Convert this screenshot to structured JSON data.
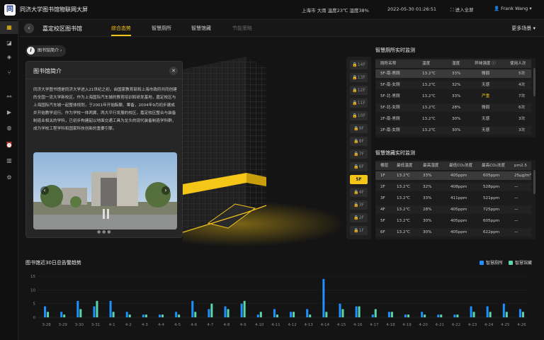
{
  "app": {
    "logo_char": "同",
    "title": "同济大学图书馆物联网大屏"
  },
  "topbar": {
    "location": "上海市",
    "weather": "大雨",
    "temperature": "温度23℃",
    "humidity": "湿度38%",
    "datetime": "2022-05-30 01:26:51",
    "fullscreen_label": "进入全屏",
    "user": "Frank Wang"
  },
  "sidebar": {
    "icons": [
      "dashboard-icon",
      "chart-icon",
      "layers-icon",
      "branch-icon",
      "network-icon",
      "video-icon",
      "palette-icon",
      "alarm-icon",
      "bar-chart-icon",
      "settings-icon"
    ]
  },
  "nav": {
    "title": "嘉定校区图书馆",
    "tabs": [
      {
        "label": "综合态势",
        "state": "active"
      },
      {
        "label": "智慧厕所",
        "state": "normal"
      },
      {
        "label": "智慧馆藏",
        "state": "normal"
      },
      {
        "label": "节能策略",
        "state": "disabled"
      }
    ],
    "scenes_label": "更多场景"
  },
  "intro": {
    "pill_label": "图书馆简介",
    "card_title": "图书馆简介",
    "text": "同济大学图书馆是同济大学进入21世纪之初，由国家教育部和上海市政府共同创建的全国一流大学新校区。作为上海国际汽车城的教育培训和研发基地，嘉定校区与上海国际汽车城一起整体规划，于2001年开始酝酿、筹备，2004年9月初步建成并开始教学运行。作为学校一体两翼、两大平行发展的校区，嘉定校区整合与装备制造业相关的学科，已初步构建起以地面交通工具为龙头的现代装备制造学科群，成为学校工程学科和国家科技创新的重要引擎。",
    "carousel_dots": "● ● ●"
  },
  "floors": [
    "14F",
    "13F",
    "12F",
    "11F",
    "10F",
    "9F",
    "8F",
    "7F",
    "6F",
    "5F",
    "4F",
    "3F",
    "2F",
    "1F"
  ],
  "selected_floor": "5F",
  "toilet": {
    "title": "智慧厕所实时监测",
    "headers": [
      "厕所名称",
      "温度",
      "湿度",
      "异味强度",
      "使用人次"
    ],
    "rows": [
      [
        "5F-南-男厕",
        "13.2℃",
        "33%",
        "微弱",
        "5次"
      ],
      [
        "5F-南-女厕",
        "13.2℃",
        "32%",
        "无感",
        "4次"
      ],
      [
        "5F-北-男厕",
        "13.2℃",
        "33%",
        "严重",
        "7次"
      ],
      [
        "5F-北-女厕",
        "13.2℃",
        "28%",
        "微弱",
        "6次"
      ],
      [
        "2F-南-男厕",
        "13.2℃",
        "30%",
        "无感",
        "3次"
      ],
      [
        "2F-南-女厕",
        "13.2℃",
        "30%",
        "无感",
        "3次"
      ]
    ]
  },
  "collection": {
    "title": "智慧馆藏实时监测",
    "headers": [
      "楼层",
      "最低温度",
      "最高湿度",
      "最低CO₂浓度",
      "最高CO₂浓度",
      "pm2.5"
    ],
    "rows": [
      [
        "1F",
        "13.2℃",
        "33%",
        "405ppm",
        "605ppm",
        "25μg/m³"
      ],
      [
        "2F",
        "13.2℃",
        "32%",
        "408ppm",
        "528ppm",
        "—"
      ],
      [
        "3F",
        "13.2℃",
        "33%",
        "411ppm",
        "521ppm",
        "—"
      ],
      [
        "4F",
        "13.2℃",
        "28%",
        "405ppm",
        "725ppm",
        "—"
      ],
      [
        "5F",
        "13.2℃",
        "30%",
        "405ppm",
        "605ppm",
        "—"
      ],
      [
        "6F",
        "13.2℃",
        "30%",
        "405ppm",
        "622ppm",
        "—"
      ]
    ]
  },
  "chart_data": {
    "type": "bar",
    "title": "图书馆近30日总告警趋势",
    "legend": "top-right",
    "categories": [
      "3-28",
      "3-29",
      "3-30",
      "3-31",
      "4-1",
      "4-2",
      "4-3",
      "4-4",
      "4-5",
      "4-6",
      "4-7",
      "4-8",
      "4-9",
      "4-10",
      "4-11",
      "4-12",
      "4-13",
      "4-14",
      "4-15",
      "4-16",
      "4-17",
      "4-18",
      "4-19",
      "4-20",
      "4-21",
      "4-22",
      "4-23",
      "4-24",
      "4-25",
      "4-26"
    ],
    "series": [
      {
        "name": "智慧厕所",
        "color": "#1e90ff",
        "values": [
          4,
          2,
          6,
          4,
          6,
          2,
          1,
          1,
          2,
          6,
          3,
          4,
          5,
          1,
          3,
          2,
          3,
          14,
          5,
          4,
          1,
          2,
          1,
          2,
          1,
          1,
          4,
          4,
          5,
          3
        ]
      },
      {
        "name": "智慧馆藏",
        "color": "#5cd6a8",
        "values": [
          2,
          1,
          3,
          6,
          2,
          1,
          1,
          1,
          1,
          2,
          5,
          3,
          6,
          2,
          1,
          2,
          1,
          2,
          3,
          4,
          3,
          2,
          1,
          1,
          1,
          1,
          2,
          2,
          2,
          2
        ]
      }
    ],
    "ylim": [
      0,
      15
    ],
    "yticks": [
      0,
      5,
      10,
      15
    ],
    "grid": true
  }
}
